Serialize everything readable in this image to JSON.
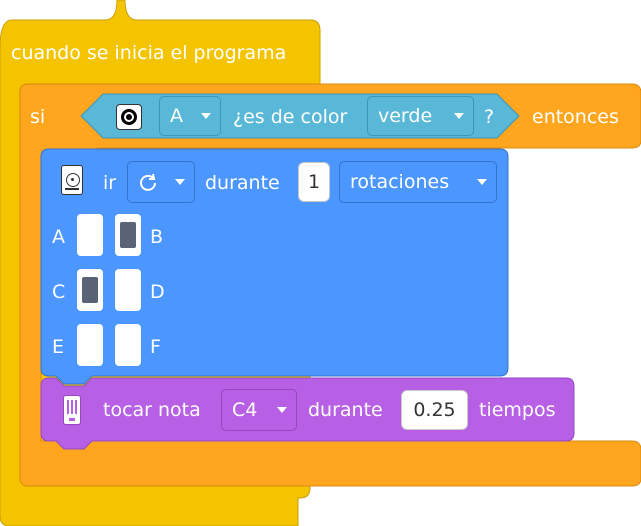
{
  "hat_block": {
    "label": "cuando se inicia el programa"
  },
  "if_block": {
    "si_label": "si",
    "entonces_label": "entonces",
    "condition": {
      "port_value": "A",
      "text": "¿es de color",
      "color_value": "verde",
      "question": "?"
    }
  },
  "move_block": {
    "ir_label": "ir",
    "direction_icon": "rotate-clockwise-icon",
    "durante_label": "durante",
    "amount": "1",
    "unit_value": "rotaciones",
    "ports": [
      {
        "label": "A",
        "on": false
      },
      {
        "label": "B",
        "on": true
      },
      {
        "label": "C",
        "on": true
      },
      {
        "label": "D",
        "on": false
      },
      {
        "label": "E",
        "on": false
      },
      {
        "label": "F",
        "on": false
      }
    ]
  },
  "sound_block": {
    "tocar_label": "tocar nota",
    "note_value": "C4",
    "durante_label": "durante",
    "duration": "0.25",
    "tiempos_label": "tiempos"
  },
  "colors": {
    "event_yellow": "#f5c400",
    "control_orange": "#ffa61e",
    "sensor_blue": "#59b7d8",
    "motor_blue": "#4c97ff",
    "sound_purple": "#b760e6"
  }
}
